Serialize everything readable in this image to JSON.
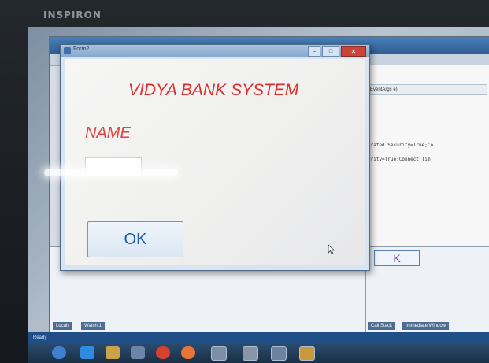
{
  "bezel": {
    "brand": "INSPIRON"
  },
  "form": {
    "title": "Form2",
    "heading": "VIDYA BANK SYSTEM",
    "name_label": "NAME",
    "ok_label": "OK"
  },
  "ide": {
    "code_tab": "EventArgs e)",
    "code_lines": [
      "grated Security=True;Co",
      "urity=True;Connect Tim"
    ],
    "bottom_tabs": {
      "locals": "Locals",
      "watch": "Watch 1",
      "callstack": "Call Stack",
      "immediate": "Immediate Window"
    },
    "ghost_button_label": "K",
    "status": "Ready"
  },
  "colors": {
    "heading": "#e02b2b",
    "label": "#e24141",
    "ok_text": "#1e5aa8"
  }
}
